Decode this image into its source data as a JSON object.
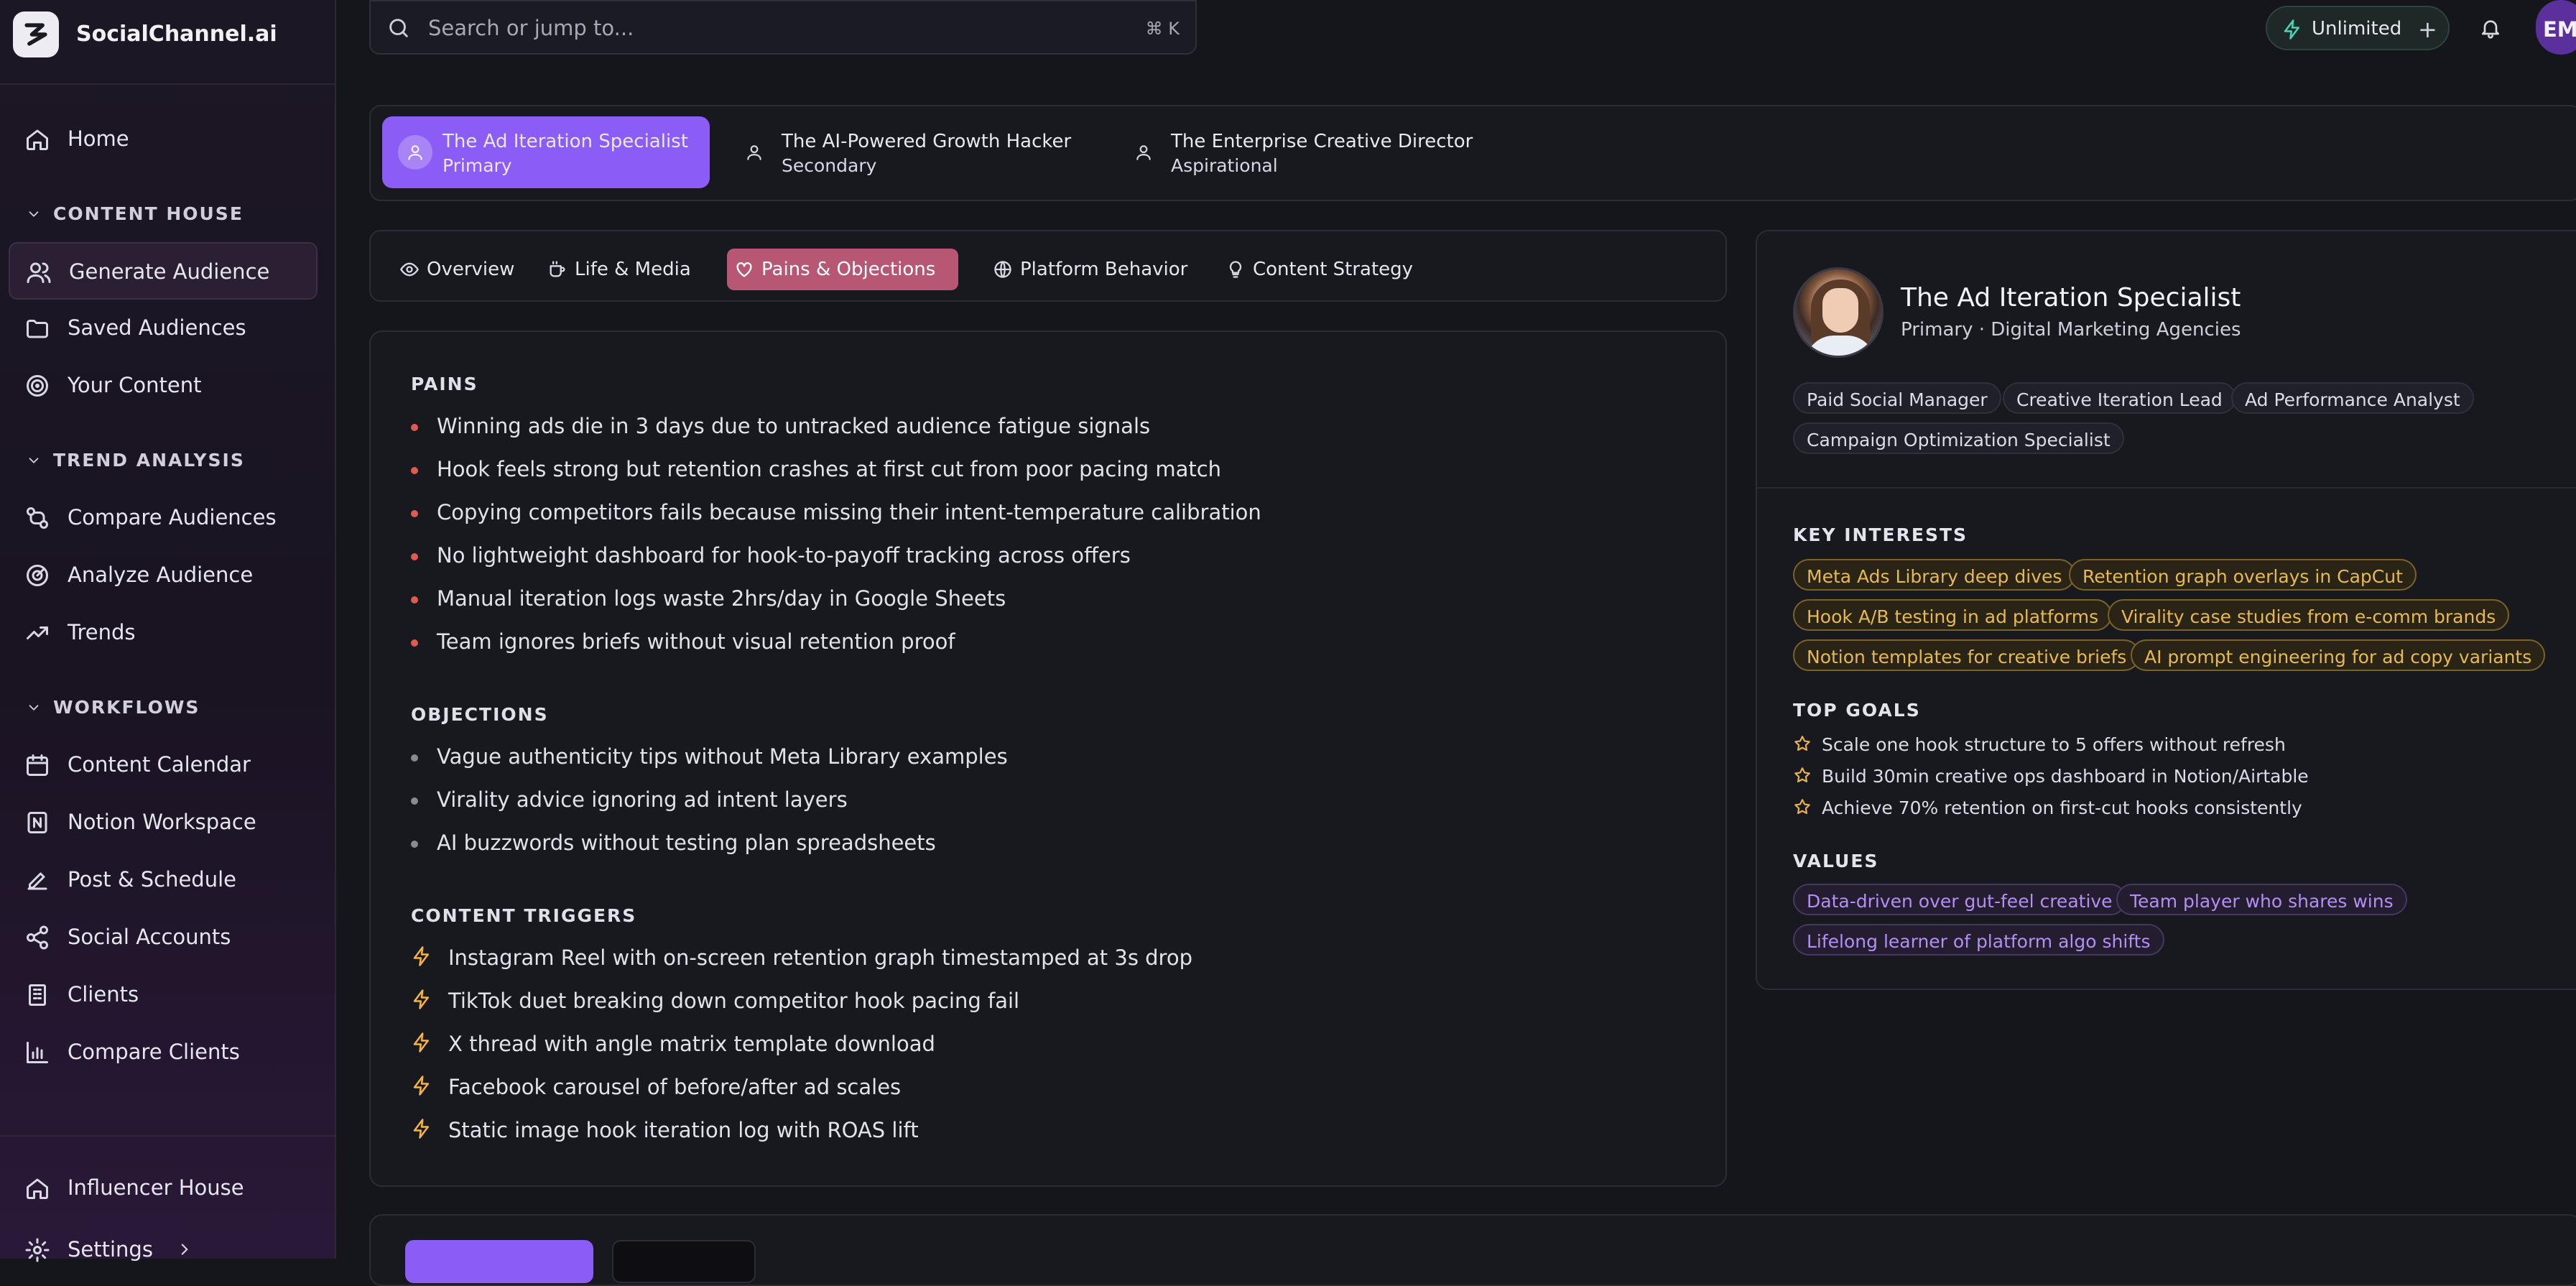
{
  "brand": {
    "name": "SocialChannel.ai"
  },
  "search": {
    "placeholder": "Search or jump to...",
    "shortcut": "⌘ K"
  },
  "header": {
    "plan_label": "Unlimited",
    "plan_add": "+",
    "avatar_initials": "EM"
  },
  "sidebar": {
    "home": "Home",
    "content_house": {
      "title": "CONTENT HOUSE",
      "items": [
        "Generate Audience",
        "Saved Audiences",
        "Your Content"
      ]
    },
    "trend_analysis": {
      "title": "TREND ANALYSIS",
      "items": [
        "Compare Audiences",
        "Analyze Audience",
        "Trends"
      ]
    },
    "workflows": {
      "title": "WORKFLOWS",
      "items": [
        "Content Calendar",
        "Notion Workspace",
        "Post & Schedule",
        "Social Accounts",
        "Clients",
        "Compare Clients"
      ]
    },
    "influencer_house": "Influencer House",
    "settings": "Settings"
  },
  "personas": [
    {
      "title": "The Ad Iteration Specialist",
      "subtitle": "Primary"
    },
    {
      "title": "The AI-Powered Growth Hacker",
      "subtitle": "Secondary"
    },
    {
      "title": "The Enterprise Creative Director",
      "subtitle": "Aspirational"
    }
  ],
  "tabs": [
    "Overview",
    "Life & Media",
    "Pains & Objections",
    "Platform Behavior",
    "Content Strategy"
  ],
  "pains": {
    "title": "PAINS",
    "items": [
      "Winning ads die in 3 days due to untracked audience fatigue signals",
      "Hook feels strong but retention crashes at first cut from poor pacing match",
      "Copying competitors fails because missing their intent-temperature calibration",
      "No lightweight dashboard for hook-to-payoff tracking across offers",
      "Manual iteration logs waste 2hrs/day in Google Sheets",
      "Team ignores briefs without visual retention proof"
    ]
  },
  "objections": {
    "title": "OBJECTIONS",
    "items": [
      "Vague authenticity tips without Meta Library examples",
      "Virality advice ignoring ad intent layers",
      "AI buzzwords without testing plan spreadsheets"
    ]
  },
  "triggers": {
    "title": "CONTENT TRIGGERS",
    "items": [
      "Instagram Reel with on-screen retention graph timestamped at 3s drop",
      "TikTok duet breaking down competitor hook pacing fail",
      "X thread with angle matrix template download",
      "Facebook carousel of before/after ad scales",
      "Static image hook iteration log with ROAS lift"
    ]
  },
  "profile": {
    "name": "The Ad Iteration Specialist",
    "subtitle": "Primary · Digital Marketing Agencies",
    "roles": [
      "Paid Social Manager",
      "Creative Iteration Lead",
      "Ad Performance Analyst",
      "Campaign Optimization Specialist"
    ],
    "interests_title": "KEY INTERESTS",
    "interests": [
      "Meta Ads Library deep dives",
      "Retention graph overlays in CapCut",
      "Hook A/B testing in ad platforms",
      "Virality case studies from e-comm brands",
      "Notion templates for creative briefs",
      "AI prompt engineering for ad copy variants"
    ],
    "goals_title": "TOP GOALS",
    "goals": [
      "Scale one hook structure to 5 offers without refresh",
      "Build 30min creative ops dashboard in Notion/Airtable",
      "Achieve 70% retention on first-cut hooks consistently"
    ],
    "values_title": "VALUES",
    "values": [
      "Data-driven over gut-feel creative",
      "Team player who shares wins",
      "Lifelong learner of platform algo shifts"
    ]
  },
  "colors": {
    "accent": "#8b5cf6",
    "active_tab": "#b85773",
    "pain_dot": "#e05a4f",
    "objection_dot": "#8a8a96",
    "trigger_icon": "#f2b544"
  }
}
